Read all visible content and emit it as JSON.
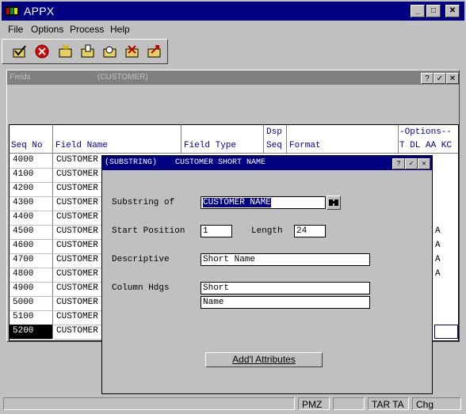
{
  "app": {
    "title": "APPX"
  },
  "menu": [
    "File",
    "Options",
    "Process",
    "Help"
  ],
  "toolbar": {
    "icons": [
      "check-folder-icon",
      "cancel-icon",
      "new-folder-icon",
      "edit-folder-icon",
      "find-folder-icon",
      "delete-folder-icon",
      "export-folder-icon"
    ]
  },
  "fields_window": {
    "title": "Fields",
    "context": "(CUSTOMER)",
    "headers": {
      "seq_no": "Seq No",
      "field_name": "Field Name",
      "field_type": "Field Type",
      "dsp": "Dsp",
      "seq": "Seq",
      "format": "Format",
      "options": "-Options--",
      "options_cols": "T DL AA KC"
    },
    "rows": [
      {
        "seq": "4000",
        "name": "CUSTOMER",
        "opt": ""
      },
      {
        "seq": "4100",
        "name": "CUSTOMER",
        "opt": ""
      },
      {
        "seq": "4200",
        "name": "CUSTOMER",
        "opt": ""
      },
      {
        "seq": "4300",
        "name": "CUSTOMER",
        "opt": ""
      },
      {
        "seq": "4400",
        "name": "CUSTOMER",
        "opt": ""
      },
      {
        "seq": "4500",
        "name": "CUSTOMER",
        "opt": "A"
      },
      {
        "seq": "4600",
        "name": "CUSTOMER",
        "opt": "A"
      },
      {
        "seq": "4700",
        "name": "CUSTOMER",
        "opt": "A"
      },
      {
        "seq": "4800",
        "name": "CUSTOMER",
        "opt": "A"
      },
      {
        "seq": "4900",
        "name": "CUSTOMER",
        "opt": ""
      },
      {
        "seq": "5000",
        "name": "CUSTOMER",
        "opt": ""
      },
      {
        "seq": "5100",
        "name": "CUSTOMER",
        "opt": ""
      },
      {
        "seq": "5200",
        "name": "CUSTOMER",
        "opt": ""
      }
    ],
    "selected_seq": "5200"
  },
  "dialog": {
    "type": "(SUBSTRING)",
    "title": "CUSTOMER SHORT NAME",
    "substring_of_label": "Substring of",
    "substring_of_value": "CUSTOMER NAME",
    "start_position_label": "Start Position",
    "start_position_value": "1",
    "length_label": "Length",
    "length_value": "24",
    "descriptive_label": "Descriptive",
    "descriptive_value": "Short Name",
    "column_hdgs_label": "Column Hdgs",
    "column_hdg_1": "Short",
    "column_hdg_2": "Name",
    "attributes_button": "Add'l Attributes"
  },
  "status": [
    "",
    "PMZ",
    "",
    "TAR TA",
    "Chg"
  ],
  "colors": {
    "title_active": "#000080",
    "title_inactive": "#808080",
    "header_text": "#0000a0"
  }
}
